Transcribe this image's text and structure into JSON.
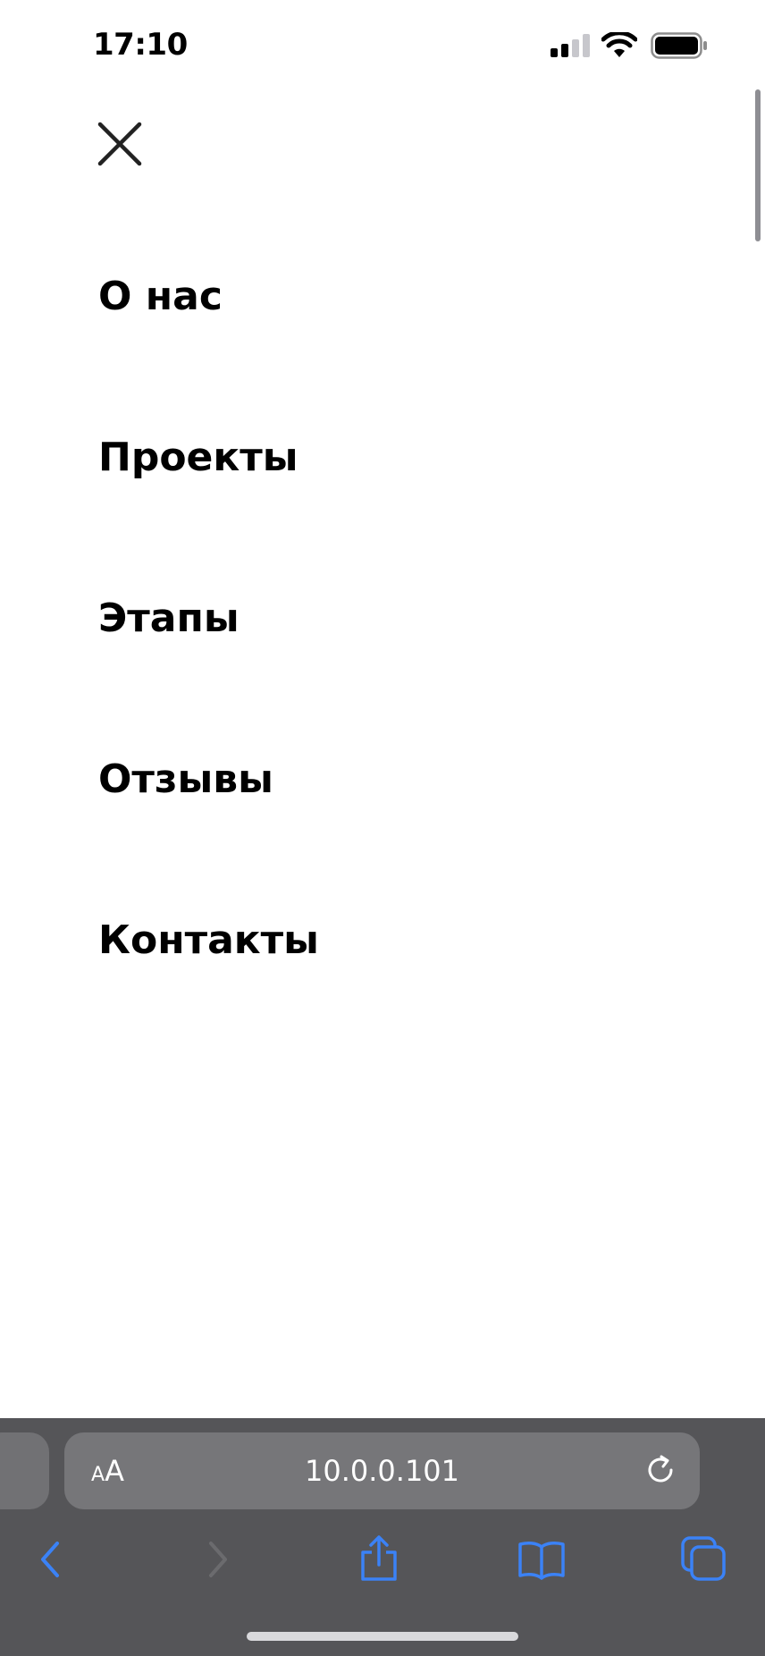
{
  "status_bar": {
    "time": "17:10"
  },
  "menu": {
    "items": [
      {
        "label": "О нас"
      },
      {
        "label": "Проекты"
      },
      {
        "label": "Этапы"
      },
      {
        "label": "Отзывы"
      },
      {
        "label": "Контакты"
      }
    ]
  },
  "browser": {
    "aa_small": "A",
    "aa_big": "A",
    "url": "10.0.0.101"
  },
  "colors": {
    "background": "#ffffff",
    "text": "#000000",
    "chrome": "#555558",
    "address_bar": "#767679",
    "accent": "#3b82f6"
  }
}
